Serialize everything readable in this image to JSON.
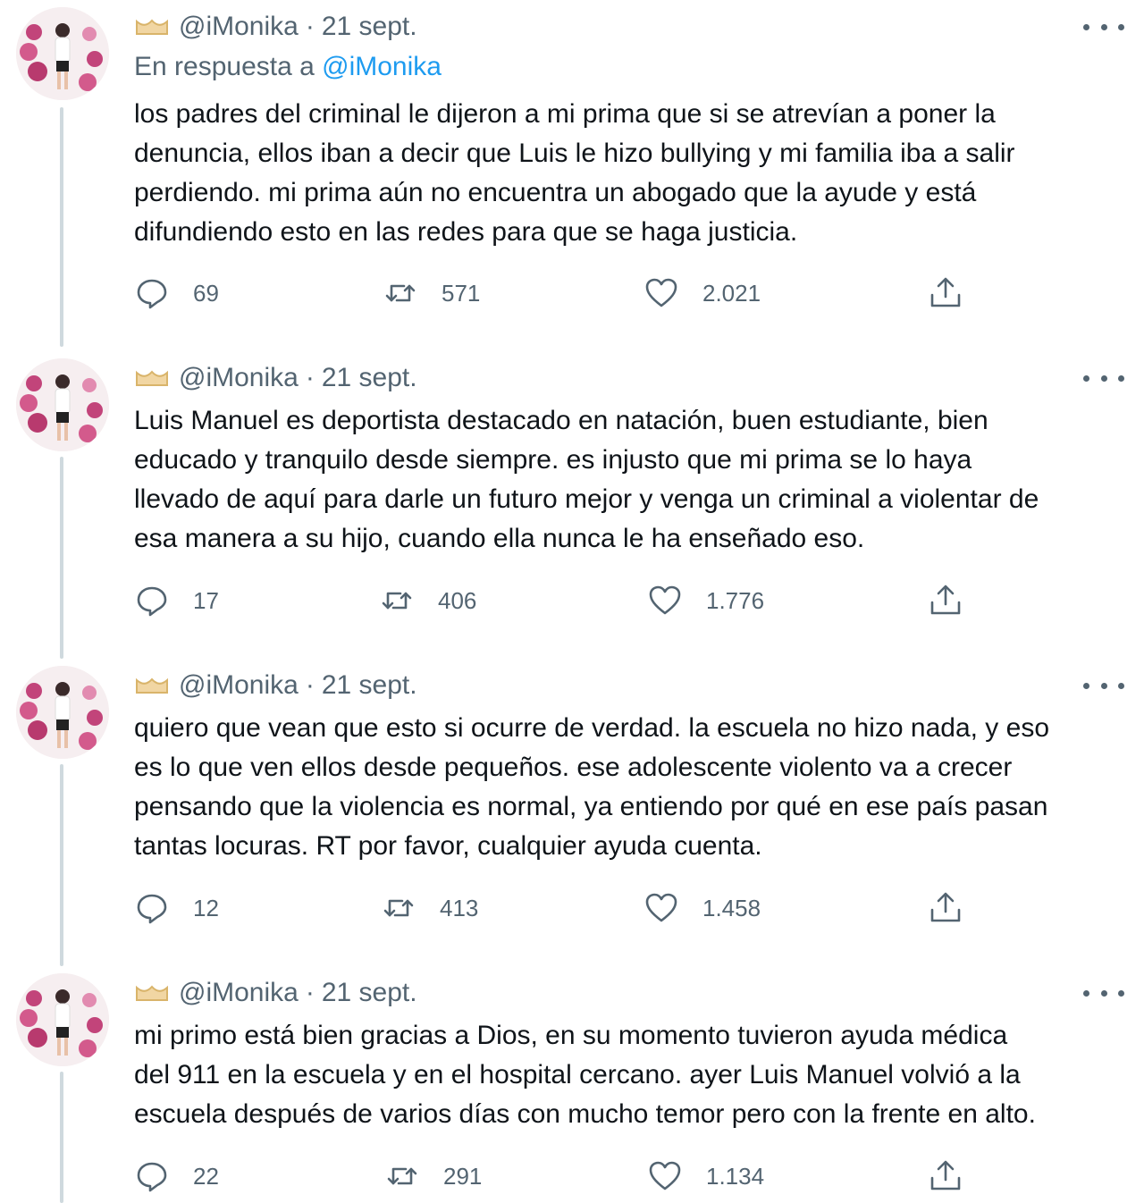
{
  "colors": {
    "text": "#0f1419",
    "secondary": "#536471",
    "link": "#1d9bf0",
    "thread_line": "#cfd9de"
  },
  "icons": {
    "badge": "gold-badge-icon",
    "more": "more-options-icon",
    "reply": "reply-icon",
    "retweet": "retweet-icon",
    "like": "heart-icon",
    "share": "share-icon"
  },
  "tweets": [
    {
      "handle": "@iMonika",
      "separator": "·",
      "date": "21 sept.",
      "reply_prefix": "En respuesta a",
      "reply_mention": "@iMonika",
      "text": "los padres del criminal le dijeron a mi prima que si se atrevían a poner la\ndenuncia, ellos iban a decir que Luis le hizo bullying y mi familia iba a salir\nperdiendo. mi prima aún no encuentra un abogado que la ayude y está\ndifundiendo esto en las redes para que se haga justicia.",
      "replies": "69",
      "retweets": "571",
      "likes": "2.021"
    },
    {
      "handle": "@iMonika",
      "separator": "·",
      "date": "21 sept.",
      "text": "Luis Manuel es deportista destacado en natación, buen estudiante, bien\neducado y tranquilo desde siempre. es injusto que mi prima se lo haya\nllevado de aquí para darle un futuro mejor y venga un criminal a violentar de\nesa manera a su hijo, cuando ella nunca le ha enseñado eso.",
      "replies": "17",
      "retweets": "406",
      "likes": "1.776"
    },
    {
      "handle": "@iMonika",
      "separator": "·",
      "date": "21 sept.",
      "text": "quiero que vean que esto si ocurre de verdad. la escuela no hizo nada, y eso\nes lo que ven ellos desde pequeños. ese adolescente violento va a crecer\npensando que la violencia es normal, ya entiendo por qué en ese país pasan\ntantas locuras. RT por favor, cualquier ayuda cuenta.",
      "replies": "12",
      "retweets": "413",
      "likes": "1.458"
    },
    {
      "handle": "@iMonika",
      "separator": "·",
      "date": "21 sept.",
      "text": "mi primo está bien gracias a Dios, en su momento tuvieron ayuda médica\ndel 911 en la escuela y en el hospital cercano. ayer Luis Manuel volvió a la\nescuela después de varios días con mucho temor pero con la frente en alto.",
      "replies": "22",
      "retweets": "291",
      "likes": "1.134"
    }
  ]
}
